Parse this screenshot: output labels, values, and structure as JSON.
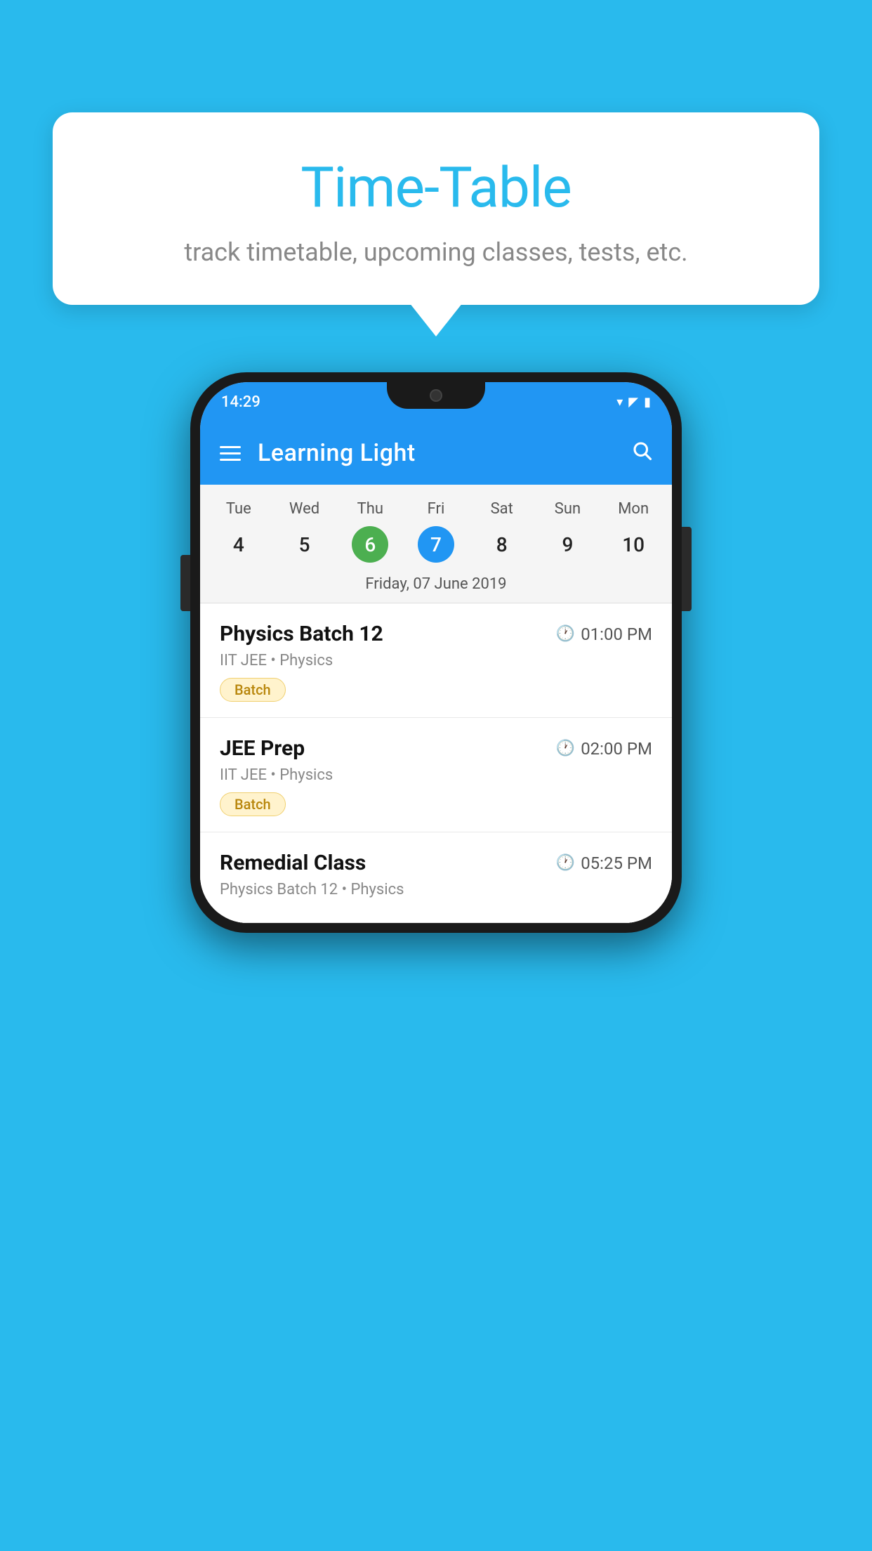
{
  "background_color": "#29BAED",
  "tooltip": {
    "title": "Time-Table",
    "subtitle": "track timetable, upcoming classes, tests, etc."
  },
  "phone": {
    "status_bar": {
      "time": "14:29"
    },
    "app_bar": {
      "title": "Learning Light",
      "menu_icon": "menu-icon",
      "search_icon": "search-icon"
    },
    "calendar": {
      "days": [
        "Tue",
        "Wed",
        "Thu",
        "Fri",
        "Sat",
        "Sun",
        "Mon"
      ],
      "dates": [
        "4",
        "5",
        "6",
        "7",
        "8",
        "9",
        "10"
      ],
      "today_index": 2,
      "selected_index": 3,
      "selected_date_label": "Friday, 07 June 2019"
    },
    "classes": [
      {
        "name": "Physics Batch 12",
        "time": "01:00 PM",
        "subtitle": "IIT JEE • Physics",
        "tag": "Batch"
      },
      {
        "name": "JEE Prep",
        "time": "02:00 PM",
        "subtitle": "IIT JEE • Physics",
        "tag": "Batch"
      },
      {
        "name": "Remedial Class",
        "time": "05:25 PM",
        "subtitle": "Physics Batch 12 • Physics",
        "tag": ""
      }
    ]
  }
}
